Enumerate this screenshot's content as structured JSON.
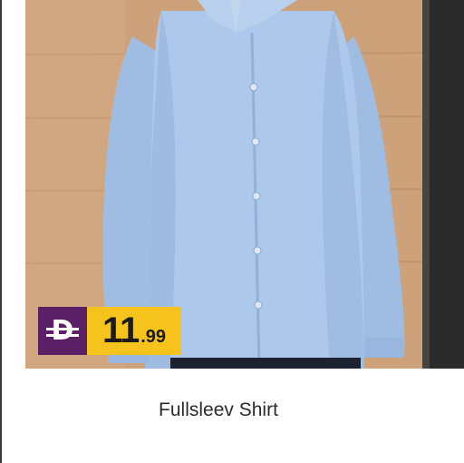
{
  "product": {
    "name": "Fullsleev Shirt",
    "image_subject": "light-blue-full-sleeve-shirt"
  },
  "price": {
    "currency_icon": "dirham-icon",
    "integer": "11",
    "fraction": ".99"
  },
  "colors": {
    "currency_bg": "#5b1f66",
    "price_bg": "#f6c31c",
    "shirt": "#a9c4e6",
    "backdrop": "#cfa579"
  }
}
